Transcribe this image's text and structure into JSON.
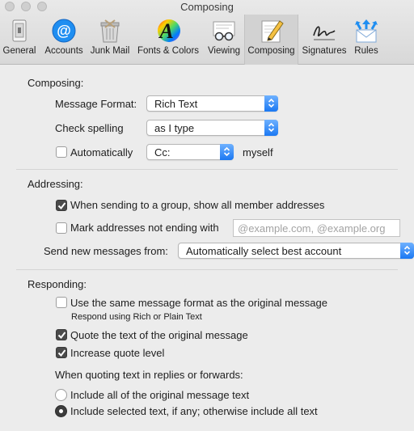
{
  "window": {
    "title": "Composing"
  },
  "toolbar": {
    "items": [
      {
        "label": "General",
        "icon": "general-icon"
      },
      {
        "label": "Accounts",
        "icon": "accounts-icon"
      },
      {
        "label": "Junk Mail",
        "icon": "junk-mail-icon"
      },
      {
        "label": "Fonts & Colors",
        "icon": "fonts-colors-icon"
      },
      {
        "label": "Viewing",
        "icon": "viewing-icon"
      },
      {
        "label": "Composing",
        "icon": "composing-icon",
        "selected": true
      },
      {
        "label": "Signatures",
        "icon": "signatures-icon"
      },
      {
        "label": "Rules",
        "icon": "rules-icon"
      }
    ]
  },
  "composing": {
    "section_label": "Composing:",
    "message_format_label": "Message Format:",
    "message_format_value": "Rich Text",
    "check_spelling_label": "Check spelling",
    "check_spelling_value": "as I type",
    "automatically_label": "Automatically",
    "automatically_checked": false,
    "cc_value": "Cc:",
    "myself_label": "myself"
  },
  "addressing": {
    "section_label": "Addressing:",
    "group_label": "When sending to a group, show all member addresses",
    "group_checked": true,
    "mark_label": "Mark addresses not ending with",
    "mark_checked": false,
    "mark_placeholder": "@example.com, @example.org",
    "send_from_label": "Send new messages from:",
    "send_from_value": "Automatically select best account"
  },
  "responding": {
    "section_label": "Responding:",
    "same_format_label": "Use the same message format as the original message",
    "same_format_checked": false,
    "same_format_hint": "Respond using Rich or Plain Text",
    "quote_label": "Quote the text of the original message",
    "quote_checked": true,
    "increase_label": "Increase quote level",
    "increase_checked": true,
    "quoting_heading": "When quoting text in replies or forwards:",
    "include_all_label": "Include all of the original message text",
    "include_selected_label": "Include selected text, if any; otherwise include all text",
    "selected_option": "include_selected"
  },
  "colors": {
    "accent": "#1b78f2",
    "window_bg": "#ececec"
  }
}
